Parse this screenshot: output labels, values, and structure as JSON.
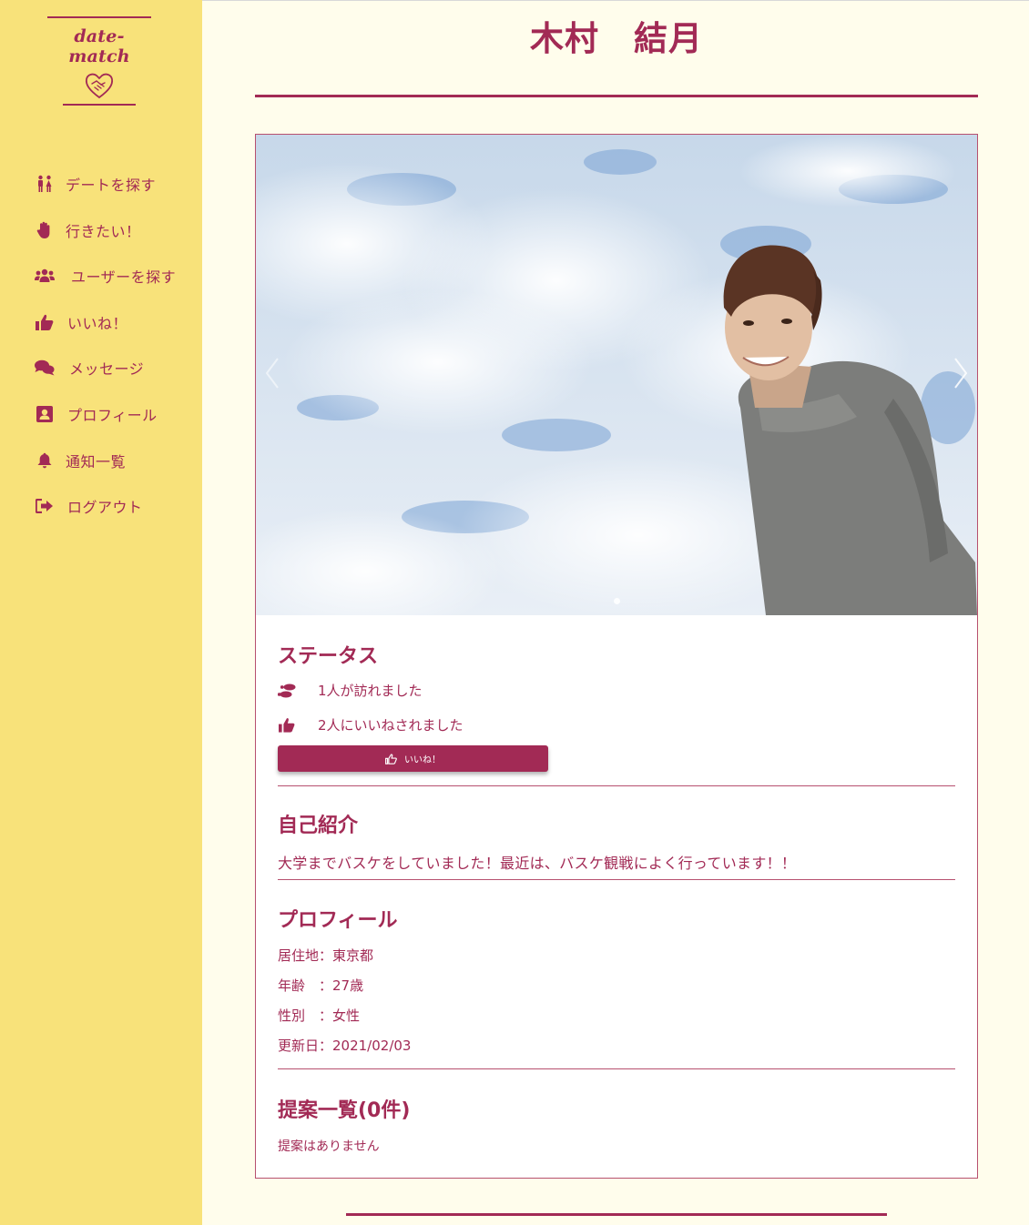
{
  "app": {
    "brand": "date-match"
  },
  "sidebar": {
    "items": [
      {
        "label": "デートを探す",
        "icon": "couple-icon"
      },
      {
        "label": "行きたい！",
        "icon": "raised-hand-icon"
      },
      {
        "label": "ユーザーを探す",
        "icon": "users-icon"
      },
      {
        "label": "いいね！",
        "icon": "thumbs-up-icon"
      },
      {
        "label": "メッセージ",
        "icon": "chat-bubbles-icon"
      },
      {
        "label": "プロフィール",
        "icon": "profile-card-icon"
      },
      {
        "label": "通知一覧",
        "icon": "bell-icon"
      },
      {
        "label": "ログアウト",
        "icon": "sign-out-icon"
      }
    ]
  },
  "profile": {
    "name": "木村　結月"
  },
  "status": {
    "heading": "ステータス",
    "visits": "1人が訪れました",
    "likes": "2人にいいねされました",
    "like_button": "いいね！"
  },
  "intro": {
    "heading": "自己紹介",
    "text": "大学までバスケをしていました！最近は、バスケ観戦によく行っています！！"
  },
  "details": {
    "heading": "プロフィール",
    "residence": "居住地：東京都",
    "age": "年齢　：27歳",
    "gender": "性別　：女性",
    "updated": "更新日：2021/02/03"
  },
  "proposals": {
    "heading": "提案一覧(0件)",
    "empty": "提案はありません"
  },
  "colors": {
    "accent": "#a22a55",
    "sidebar": "#f8e27a",
    "page": "#fffdec"
  }
}
